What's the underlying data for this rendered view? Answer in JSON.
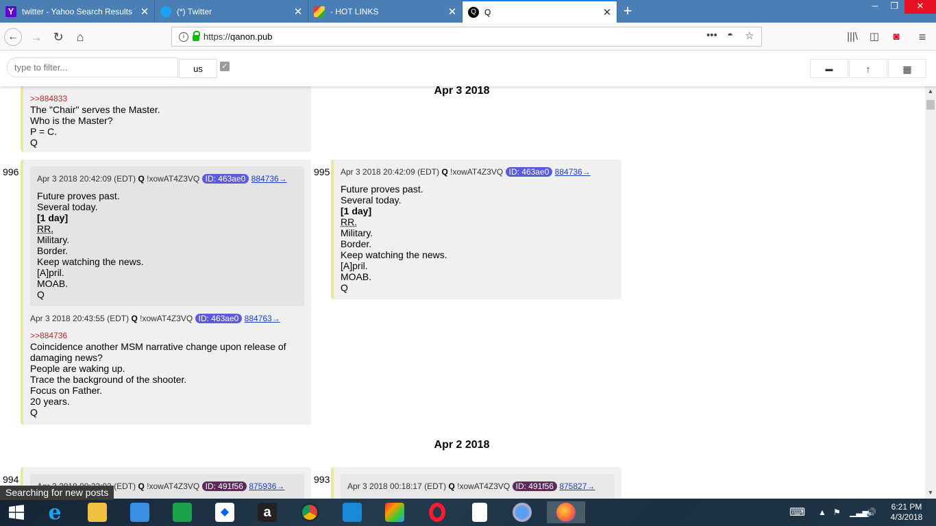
{
  "browser": {
    "tabs": [
      {
        "title": "twitter - Yahoo Search Results Y"
      },
      {
        "title": "(*) Twitter"
      },
      {
        "title": "- HOT LINKS"
      },
      {
        "title": "Q"
      }
    ],
    "url_protocol": "https://",
    "url_host": "qanon.pub"
  },
  "filterbar": {
    "placeholder": "type to filter...",
    "selected": "us"
  },
  "posts": {
    "top_fragment": {
      "ref": ">>884833",
      "lines": [
        "The \"Chair\" serves the Master.",
        "Who is the Master?",
        "P = C.",
        "Q"
      ]
    },
    "date_apr3": "Apr 3 2018",
    "p996": {
      "num": "996",
      "quote": {
        "date": "Apr 3 2018 20:42:09 (EDT)",
        "name": "Q",
        "trip": "!xowAT4Z3VQ",
        "id": "ID: 463ae0",
        "link": "884736→",
        "lines": [
          "Future proves past.",
          "Several today.",
          "[1 day]",
          "RR.",
          "Military.",
          "Border.",
          "Keep watching the news.",
          "[A]pril.",
          "MOAB.",
          "Q"
        ]
      },
      "date": "Apr 3 2018 20:43:55 (EDT)",
      "name": "Q",
      "trip": "!xowAT4Z3VQ",
      "id": "ID: 463ae0",
      "link": "884763→",
      "ref": ">>884736",
      "lines": [
        "Coincidence another MSM narrative change upon release of",
        "damaging news?",
        "People are waking up.",
        "Trace the background of the shooter.",
        "Focus on Father.",
        "20 years.",
        "Q"
      ]
    },
    "p995": {
      "num": "995",
      "date": "Apr 3 2018 20:42:09 (EDT)",
      "name": "Q",
      "trip": "!xowAT4Z3VQ",
      "id": "ID: 463ae0",
      "link": "884736→",
      "lines": [
        "Future proves past.",
        "Several today.",
        "[1 day]",
        "RR.",
        "Military.",
        "Border.",
        "Keep watching the news.",
        "[A]pril.",
        "MOAB.",
        "Q"
      ]
    },
    "date_apr2": "Apr 2 2018",
    "p994": {
      "num": "994",
      "date": "Apr 3 2018 00:22:02 (EDT)",
      "name": "Q",
      "trip": "!xowAT4Z3VQ",
      "id": "ID: 491f56",
      "link": "875936→"
    },
    "p993": {
      "num": "993",
      "date": "Apr 3 2018 00:18:17 (EDT)",
      "name": "Q",
      "trip": "!xowAT4Z3VQ",
      "id": "ID: 491f56",
      "link": "875827→"
    }
  },
  "status": "Searching for new posts",
  "clock": {
    "time": "6:21 PM",
    "date": "4/3/2018"
  },
  "colors": {
    "tabbar": "#4a7fb5",
    "id_badge": "#5a5ade",
    "id_badge_dark": "#5a2a5a",
    "post_border": "#e8e8a0"
  },
  "icons": [
    "yahoo-icon",
    "twitter-icon",
    "hotlinks-icon",
    "q-icon",
    "back-icon",
    "forward-icon",
    "reload-icon",
    "home-icon",
    "lock-icon",
    "library-icon",
    "sidebar-icon",
    "pocket-icon",
    "menu-icon"
  ]
}
